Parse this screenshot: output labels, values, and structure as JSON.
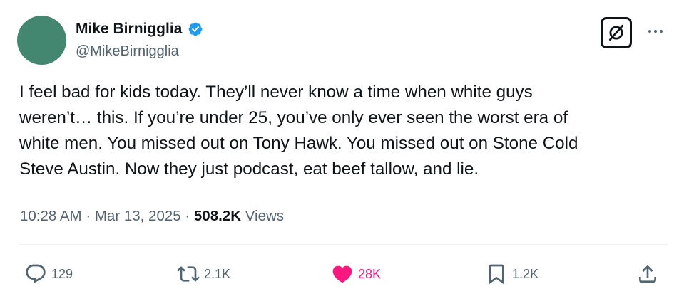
{
  "author": {
    "display_name": "Mike Birnigglia",
    "handle": "@MikeBirnigglia",
    "avatar_color": "#448771",
    "verified": true,
    "verified_color": "#1d9bf0"
  },
  "tweet": {
    "lines": [
      "I feel bad for kids today. They’ll never know a time when white guys",
      "weren’t… this. If you’re under 25, you’ve only ever seen the worst era of",
      "white men. You missed out on Tony Hawk. You missed out on Stone Cold",
      "Steve Austin. Now they just podcast, eat beef tallow, and lie."
    ],
    "time": "10:28 AM",
    "separator": "·",
    "date": "Mar 13, 2025",
    "views_count": "508.2K",
    "views_label": "Views"
  },
  "actions": {
    "replies": "129",
    "reposts": "2.1K",
    "likes": "28K",
    "bookmarks": "1.2K"
  },
  "colors": {
    "text": "#0f1419",
    "secondary": "#536471",
    "like": "#f91880"
  }
}
